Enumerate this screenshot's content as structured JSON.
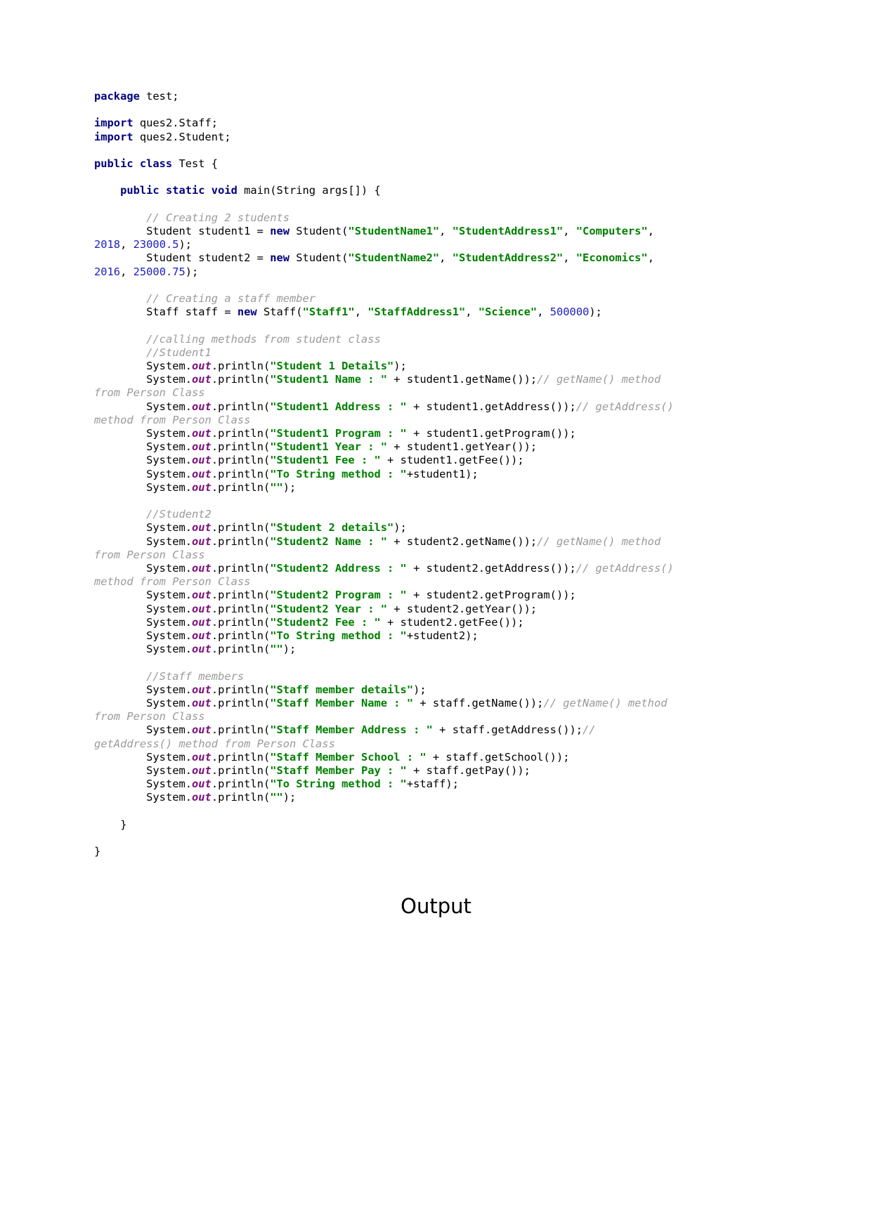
{
  "document": {
    "type": "java-source-listing",
    "heading_output": "Output",
    "colors": {
      "keyword": "#000080",
      "string": "#008000",
      "number": "#2020c0",
      "comment": "#9a9a9a",
      "field": "#7b0f7b",
      "plain": "#000000",
      "background": "#ffffff"
    }
  },
  "code": {
    "lines": [
      {
        "id": "l1",
        "tokens": [
          {
            "t": "kw",
            "v": "package"
          },
          {
            "t": "pln",
            "v": " test;"
          }
        ]
      },
      {
        "id": "l2",
        "tokens": []
      },
      {
        "id": "l3",
        "tokens": [
          {
            "t": "kw",
            "v": "import"
          },
          {
            "t": "pln",
            "v": " ques2.Staff;"
          }
        ]
      },
      {
        "id": "l4",
        "tokens": [
          {
            "t": "kw",
            "v": "import"
          },
          {
            "t": "pln",
            "v": " ques2.Student;"
          }
        ]
      },
      {
        "id": "l5",
        "tokens": []
      },
      {
        "id": "l6",
        "tokens": [
          {
            "t": "kw",
            "v": "public class"
          },
          {
            "t": "pln",
            "v": " Test {"
          }
        ]
      },
      {
        "id": "l7",
        "tokens": []
      },
      {
        "id": "l8",
        "tokens": [
          {
            "t": "pln",
            "v": "    "
          },
          {
            "t": "kw",
            "v": "public static void"
          },
          {
            "t": "pln",
            "v": " main(String args[]) {"
          }
        ]
      },
      {
        "id": "l9",
        "tokens": []
      },
      {
        "id": "l10",
        "tokens": [
          {
            "t": "pln",
            "v": "        "
          },
          {
            "t": "cmt",
            "v": "// Creating 2 students"
          }
        ]
      },
      {
        "id": "l11",
        "tokens": [
          {
            "t": "pln",
            "v": "        Student student1 = "
          },
          {
            "t": "kw",
            "v": "new"
          },
          {
            "t": "pln",
            "v": " Student("
          },
          {
            "t": "str",
            "v": "\"StudentName1\""
          },
          {
            "t": "pln",
            "v": ", "
          },
          {
            "t": "str",
            "v": "\"StudentAddress1\""
          },
          {
            "t": "pln",
            "v": ", "
          },
          {
            "t": "str",
            "v": "\"Computers\""
          },
          {
            "t": "pln",
            "v": ", "
          },
          {
            "t": "num",
            "v": "2018"
          },
          {
            "t": "pln",
            "v": ", "
          },
          {
            "t": "num",
            "v": "23000.5"
          },
          {
            "t": "pln",
            "v": ");"
          }
        ]
      },
      {
        "id": "l12",
        "tokens": [
          {
            "t": "pln",
            "v": "        Student student2 = "
          },
          {
            "t": "kw",
            "v": "new"
          },
          {
            "t": "pln",
            "v": " Student("
          },
          {
            "t": "str",
            "v": "\"StudentName2\""
          },
          {
            "t": "pln",
            "v": ", "
          },
          {
            "t": "str",
            "v": "\"StudentAddress2\""
          },
          {
            "t": "pln",
            "v": ", "
          },
          {
            "t": "str",
            "v": "\"Economics\""
          },
          {
            "t": "pln",
            "v": ", "
          },
          {
            "t": "num",
            "v": "2016"
          },
          {
            "t": "pln",
            "v": ", "
          },
          {
            "t": "num",
            "v": "25000.75"
          },
          {
            "t": "pln",
            "v": ");"
          }
        ]
      },
      {
        "id": "l13",
        "tokens": []
      },
      {
        "id": "l14",
        "tokens": [
          {
            "t": "pln",
            "v": "        "
          },
          {
            "t": "cmt",
            "v": "// Creating a staff member"
          }
        ]
      },
      {
        "id": "l15",
        "tokens": [
          {
            "t": "pln",
            "v": "        Staff staff = "
          },
          {
            "t": "kw",
            "v": "new"
          },
          {
            "t": "pln",
            "v": " Staff("
          },
          {
            "t": "str",
            "v": "\"Staff1\""
          },
          {
            "t": "pln",
            "v": ", "
          },
          {
            "t": "str",
            "v": "\"StaffAddress1\""
          },
          {
            "t": "pln",
            "v": ", "
          },
          {
            "t": "str",
            "v": "\"Science\""
          },
          {
            "t": "pln",
            "v": ", "
          },
          {
            "t": "num",
            "v": "500000"
          },
          {
            "t": "pln",
            "v": ");"
          }
        ]
      },
      {
        "id": "l16",
        "tokens": []
      },
      {
        "id": "l17",
        "tokens": [
          {
            "t": "pln",
            "v": "        "
          },
          {
            "t": "cmt",
            "v": "//calling methods from student class"
          }
        ]
      },
      {
        "id": "l18",
        "tokens": [
          {
            "t": "pln",
            "v": "        "
          },
          {
            "t": "cmt",
            "v": "//Student1"
          }
        ]
      },
      {
        "id": "l19",
        "tokens": [
          {
            "t": "pln",
            "v": "        System."
          },
          {
            "t": "fld",
            "v": "out"
          },
          {
            "t": "pln",
            "v": ".println("
          },
          {
            "t": "str",
            "v": "\"Student 1 Details\""
          },
          {
            "t": "pln",
            "v": ");"
          }
        ]
      },
      {
        "id": "l20",
        "tokens": [
          {
            "t": "pln",
            "v": "        System."
          },
          {
            "t": "fld",
            "v": "out"
          },
          {
            "t": "pln",
            "v": ".println("
          },
          {
            "t": "str",
            "v": "\"Student1 Name : \""
          },
          {
            "t": "pln",
            "v": " + student1.getName());"
          },
          {
            "t": "cmt",
            "v": "// getName() method from Person Class"
          }
        ]
      },
      {
        "id": "l21",
        "tokens": [
          {
            "t": "pln",
            "v": "        System."
          },
          {
            "t": "fld",
            "v": "out"
          },
          {
            "t": "pln",
            "v": ".println("
          },
          {
            "t": "str",
            "v": "\"Student1 Address : \""
          },
          {
            "t": "pln",
            "v": " + student1.getAddress());"
          },
          {
            "t": "cmt",
            "v": "// getAddress() method from Person Class"
          }
        ]
      },
      {
        "id": "l22",
        "tokens": [
          {
            "t": "pln",
            "v": "        System."
          },
          {
            "t": "fld",
            "v": "out"
          },
          {
            "t": "pln",
            "v": ".println("
          },
          {
            "t": "str",
            "v": "\"Student1 Program : \""
          },
          {
            "t": "pln",
            "v": " + student1.getProgram());"
          }
        ]
      },
      {
        "id": "l23",
        "tokens": [
          {
            "t": "pln",
            "v": "        System."
          },
          {
            "t": "fld",
            "v": "out"
          },
          {
            "t": "pln",
            "v": ".println("
          },
          {
            "t": "str",
            "v": "\"Student1 Year : \""
          },
          {
            "t": "pln",
            "v": " + student1.getYear());"
          }
        ]
      },
      {
        "id": "l24",
        "tokens": [
          {
            "t": "pln",
            "v": "        System."
          },
          {
            "t": "fld",
            "v": "out"
          },
          {
            "t": "pln",
            "v": ".println("
          },
          {
            "t": "str",
            "v": "\"Student1 Fee : \""
          },
          {
            "t": "pln",
            "v": " + student1.getFee());"
          }
        ]
      },
      {
        "id": "l25",
        "tokens": [
          {
            "t": "pln",
            "v": "        System."
          },
          {
            "t": "fld",
            "v": "out"
          },
          {
            "t": "pln",
            "v": ".println("
          },
          {
            "t": "str",
            "v": "\"To String method : \""
          },
          {
            "t": "pln",
            "v": "+student1);"
          }
        ]
      },
      {
        "id": "l26",
        "tokens": [
          {
            "t": "pln",
            "v": "        System."
          },
          {
            "t": "fld",
            "v": "out"
          },
          {
            "t": "pln",
            "v": ".println("
          },
          {
            "t": "str",
            "v": "\"\""
          },
          {
            "t": "pln",
            "v": ");"
          }
        ]
      },
      {
        "id": "l27",
        "tokens": []
      },
      {
        "id": "l28",
        "tokens": [
          {
            "t": "pln",
            "v": "        "
          },
          {
            "t": "cmt",
            "v": "//Student2"
          }
        ]
      },
      {
        "id": "l29",
        "tokens": [
          {
            "t": "pln",
            "v": "        System."
          },
          {
            "t": "fld",
            "v": "out"
          },
          {
            "t": "pln",
            "v": ".println("
          },
          {
            "t": "str",
            "v": "\"Student 2 details\""
          },
          {
            "t": "pln",
            "v": ");"
          }
        ]
      },
      {
        "id": "l30",
        "tokens": [
          {
            "t": "pln",
            "v": "        System."
          },
          {
            "t": "fld",
            "v": "out"
          },
          {
            "t": "pln",
            "v": ".println("
          },
          {
            "t": "str",
            "v": "\"Student2 Name : \""
          },
          {
            "t": "pln",
            "v": " + student2.getName());"
          },
          {
            "t": "cmt",
            "v": "// getName() method from Person Class"
          }
        ]
      },
      {
        "id": "l31",
        "tokens": [
          {
            "t": "pln",
            "v": "        System."
          },
          {
            "t": "fld",
            "v": "out"
          },
          {
            "t": "pln",
            "v": ".println("
          },
          {
            "t": "str",
            "v": "\"Student2 Address : \""
          },
          {
            "t": "pln",
            "v": " + student2.getAddress());"
          },
          {
            "t": "cmt",
            "v": "// getAddress() method from Person Class"
          }
        ]
      },
      {
        "id": "l32",
        "tokens": [
          {
            "t": "pln",
            "v": "        System."
          },
          {
            "t": "fld",
            "v": "out"
          },
          {
            "t": "pln",
            "v": ".println("
          },
          {
            "t": "str",
            "v": "\"Student2 Program : \""
          },
          {
            "t": "pln",
            "v": " + student2.getProgram());"
          }
        ]
      },
      {
        "id": "l33",
        "tokens": [
          {
            "t": "pln",
            "v": "        System."
          },
          {
            "t": "fld",
            "v": "out"
          },
          {
            "t": "pln",
            "v": ".println("
          },
          {
            "t": "str",
            "v": "\"Student2 Year : \""
          },
          {
            "t": "pln",
            "v": " + student2.getYear());"
          }
        ]
      },
      {
        "id": "l34",
        "tokens": [
          {
            "t": "pln",
            "v": "        System."
          },
          {
            "t": "fld",
            "v": "out"
          },
          {
            "t": "pln",
            "v": ".println("
          },
          {
            "t": "str",
            "v": "\"Student2 Fee : \""
          },
          {
            "t": "pln",
            "v": " + student2.getFee());"
          }
        ]
      },
      {
        "id": "l35",
        "tokens": [
          {
            "t": "pln",
            "v": "        System."
          },
          {
            "t": "fld",
            "v": "out"
          },
          {
            "t": "pln",
            "v": ".println("
          },
          {
            "t": "str",
            "v": "\"To String method : \""
          },
          {
            "t": "pln",
            "v": "+student2);"
          }
        ]
      },
      {
        "id": "l36",
        "tokens": [
          {
            "t": "pln",
            "v": "        System."
          },
          {
            "t": "fld",
            "v": "out"
          },
          {
            "t": "pln",
            "v": ".println("
          },
          {
            "t": "str",
            "v": "\"\""
          },
          {
            "t": "pln",
            "v": ");"
          }
        ]
      },
      {
        "id": "l37",
        "tokens": []
      },
      {
        "id": "l38",
        "tokens": [
          {
            "t": "pln",
            "v": "        "
          },
          {
            "t": "cmt",
            "v": "//Staff members"
          }
        ]
      },
      {
        "id": "l39",
        "tokens": [
          {
            "t": "pln",
            "v": "        System."
          },
          {
            "t": "fld",
            "v": "out"
          },
          {
            "t": "pln",
            "v": ".println("
          },
          {
            "t": "str",
            "v": "\"Staff member details\""
          },
          {
            "t": "pln",
            "v": ");"
          }
        ]
      },
      {
        "id": "l40",
        "tokens": [
          {
            "t": "pln",
            "v": "        System."
          },
          {
            "t": "fld",
            "v": "out"
          },
          {
            "t": "pln",
            "v": ".println("
          },
          {
            "t": "str",
            "v": "\"Staff Member Name : \""
          },
          {
            "t": "pln",
            "v": " + staff.getName());"
          },
          {
            "t": "cmt",
            "v": "// getName() method from Person Class"
          }
        ]
      },
      {
        "id": "l41",
        "tokens": [
          {
            "t": "pln",
            "v": "        System."
          },
          {
            "t": "fld",
            "v": "out"
          },
          {
            "t": "pln",
            "v": ".println("
          },
          {
            "t": "str",
            "v": "\"Staff Member Address : \""
          },
          {
            "t": "pln",
            "v": " + staff.getAddress());"
          },
          {
            "t": "cmt",
            "v": "// getAddress() method from Person Class"
          }
        ]
      },
      {
        "id": "l42",
        "tokens": [
          {
            "t": "pln",
            "v": "        System."
          },
          {
            "t": "fld",
            "v": "out"
          },
          {
            "t": "pln",
            "v": ".println("
          },
          {
            "t": "str",
            "v": "\"Staff Member School : \""
          },
          {
            "t": "pln",
            "v": " + staff.getSchool());"
          }
        ]
      },
      {
        "id": "l43",
        "tokens": [
          {
            "t": "pln",
            "v": "        System."
          },
          {
            "t": "fld",
            "v": "out"
          },
          {
            "t": "pln",
            "v": ".println("
          },
          {
            "t": "str",
            "v": "\"Staff Member Pay : \""
          },
          {
            "t": "pln",
            "v": " + staff.getPay());"
          }
        ]
      },
      {
        "id": "l44",
        "tokens": [
          {
            "t": "pln",
            "v": "        System."
          },
          {
            "t": "fld",
            "v": "out"
          },
          {
            "t": "pln",
            "v": ".println("
          },
          {
            "t": "str",
            "v": "\"To String method : \""
          },
          {
            "t": "pln",
            "v": "+staff);"
          }
        ]
      },
      {
        "id": "l45",
        "tokens": [
          {
            "t": "pln",
            "v": "        System."
          },
          {
            "t": "fld",
            "v": "out"
          },
          {
            "t": "pln",
            "v": ".println("
          },
          {
            "t": "str",
            "v": "\"\""
          },
          {
            "t": "pln",
            "v": ");"
          }
        ]
      },
      {
        "id": "l46",
        "tokens": []
      },
      {
        "id": "l47",
        "tokens": [
          {
            "t": "pln",
            "v": "    }"
          }
        ]
      },
      {
        "id": "l48",
        "tokens": []
      },
      {
        "id": "l49",
        "tokens": [
          {
            "t": "pln",
            "v": "}"
          }
        ]
      }
    ]
  }
}
